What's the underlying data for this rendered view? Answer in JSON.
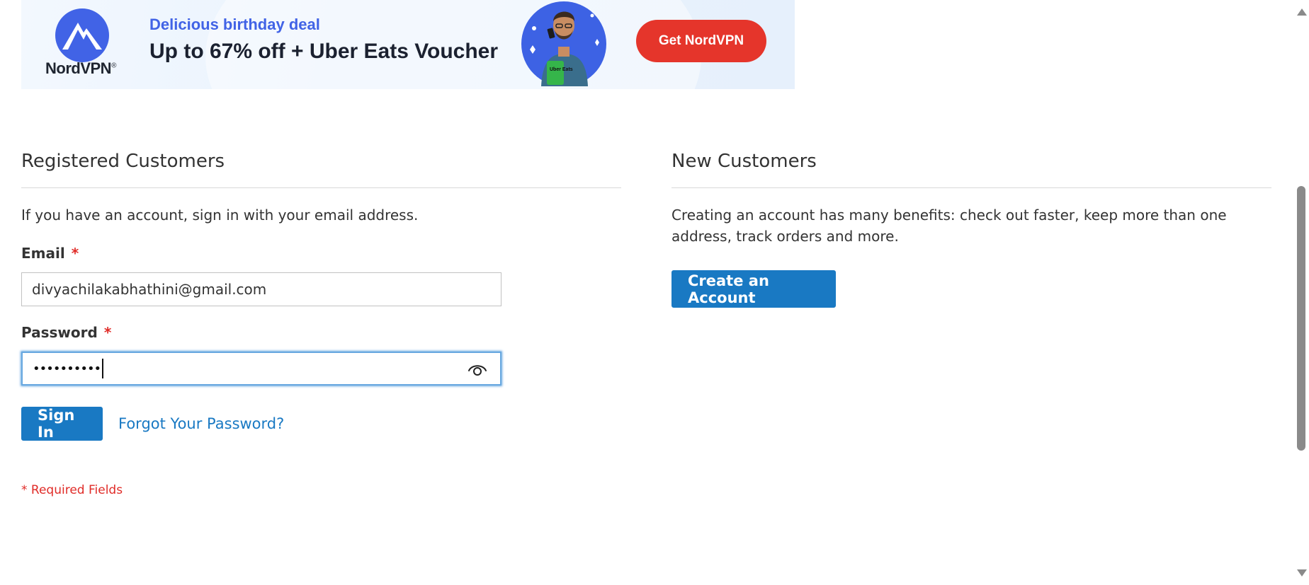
{
  "ad": {
    "brand_name": "NordVPN",
    "eyebrow": "Delicious birthday deal",
    "headline": "Up to 67% off + Uber Eats Voucher",
    "bag_text": "Uber Eats",
    "cta_label": "Get NordVPN",
    "brand_color": "#4163e6",
    "cta_color": "#e5352b"
  },
  "registered": {
    "title": "Registered Customers",
    "note": "If you have an account, sign in with your email address.",
    "email": {
      "label": "Email",
      "required_mark": "*",
      "value": "divyachilakabhathini@gmail.com"
    },
    "password": {
      "label": "Password",
      "required_mark": "*",
      "masked_value": "••••••••••",
      "toggle_icon": "eye-icon"
    },
    "sign_in_label": "Sign In",
    "forgot_label": "Forgot Your Password?",
    "required_note": "* Required Fields"
  },
  "new_customers": {
    "title": "New Customers",
    "note": "Creating an account has many benefits: check out faster, keep more than one address, track orders and more.",
    "create_label": "Create an Account"
  },
  "colors": {
    "primary": "#1979c3",
    "required": "#e02b27",
    "focus": "#68a8e0"
  }
}
